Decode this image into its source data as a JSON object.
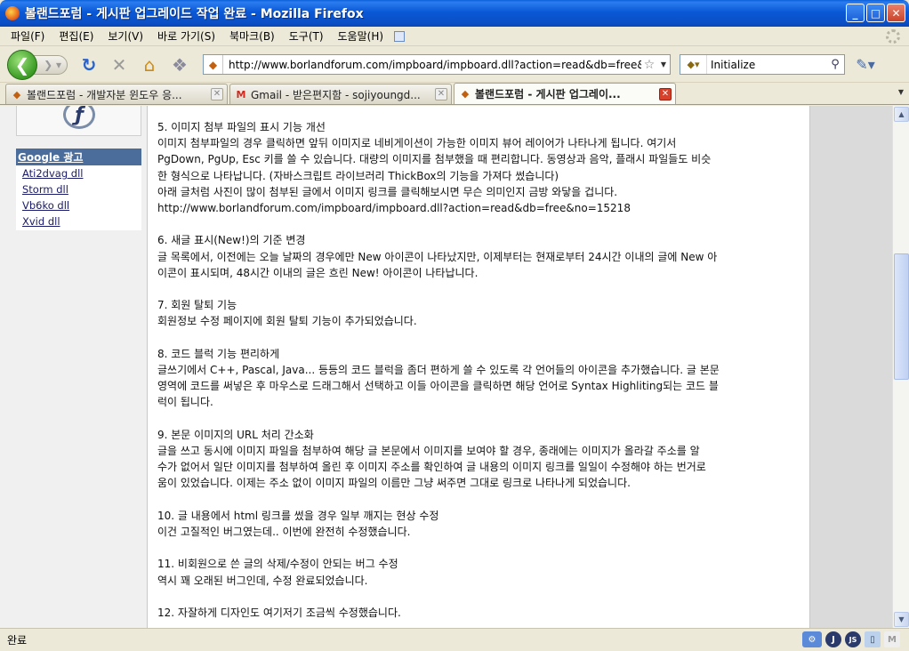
{
  "window": {
    "title": "볼랜드포럼 - 게시판 업그레이드 작업 완료 - Mozilla Firefox",
    "minimize": "_",
    "maximize": "□",
    "close": "✕"
  },
  "menu": {
    "items": [
      "파일(F)",
      "편집(E)",
      "보기(V)",
      "바로 가기(S)",
      "북마크(B)",
      "도구(T)",
      "도움말(H)"
    ]
  },
  "nav": {
    "url": "http://www.borlandforum.com/impboard/impboard.dll?action=read&db=free&no",
    "search_value": "Initialize"
  },
  "tabs": [
    {
      "label": "볼랜드포럼 - 개발자분 윈도우 응...",
      "icon": "borland-icon",
      "active": false
    },
    {
      "label": "Gmail - 받은편지함 - sojiyoungd...",
      "icon": "gmail-icon",
      "active": false
    },
    {
      "label": "볼랜드포럼 - 게시판 업그레이...",
      "icon": "borland-icon",
      "active": true
    }
  ],
  "sidebar": {
    "ads_title": "Google 광고",
    "ads": [
      "Ati2dvag dll",
      "Storm dll",
      "Vb6ko dll",
      "Xvid dll"
    ]
  },
  "article": {
    "sections": [
      {
        "heading": "5. 이미지 첨부 파일의 표시 기능 개선",
        "lines": [
          "이미지 첨부파일의 경우 클릭하면 앞뒤 이미지로 네비게이션이 가능한 이미지 뷰어 레이어가 나타나게 됩니다. 여기서",
          "PgDown, PgUp, Esc 키를 쓸 수 있습니다. 대량의 이미지를 첨부했을 때 편리합니다. 동영상과 음악, 플래시 파일들도 비슷",
          "한 형식으로 나타납니다. (자바스크립트 라이브러리 ThickBox의 기능을 가져다 썼습니다)",
          "아래 글처럼 사진이 많이 첨부된 글에서 이미지 링크를 클릭해보시면 무슨 의미인지 금방 와닿을 겁니다.",
          "http://www.borlandforum.com/impboard/impboard.dll?action=read&db=free&no=15218"
        ]
      },
      {
        "heading": "6. 새글 표시(New!)의 기준 변경",
        "lines": [
          "글 목록에서, 이전에는 오늘 날짜의 경우에만 New 아이콘이 나타났지만, 이제부터는 현재로부터 24시간 이내의 글에 New 아",
          "이콘이 표시되며, 48시간 이내의 글은 흐린 New! 아이콘이 나타납니다."
        ]
      },
      {
        "heading": "7. 회원 탈퇴 기능",
        "lines": [
          "회원정보 수정 페이지에 회원 탈퇴 기능이 추가되었습니다."
        ]
      },
      {
        "heading": "8. 코드 블럭 기능 편리하게",
        "lines": [
          "글쓰기에서 C++, Pascal, Java... 등등의 코드 블럭을 좀더 편하게 쓸 수 있도록 각 언어들의 아이콘을 추가했습니다. 글 본문",
          "영역에 코드를 써넣은 후 마우스로 드래그해서 선택하고 이들 아이콘을 클릭하면 해당 언어로 Syntax Highliting되는 코드 블",
          "럭이 됩니다."
        ]
      },
      {
        "heading": "9. 본문 이미지의 URL 처리 간소화",
        "lines": [
          "글을 쓰고 동시에 이미지 파일을 첨부하여 해당 글 본문에서 이미지를 보여야 할 경우, 종래에는 이미지가 올라갈 주소를 알",
          "수가 없어서 일단 이미지를 첨부하여 올린 후 이미지 주소를 확인하여 글 내용의 이미지 링크를 일일이 수정해야 하는 번거로",
          "움이 있었습니다. 이제는 주소 없이 이미지 파일의 이름만 그냥 써주면 그대로 링크로 나타나게 되었습니다."
        ]
      },
      {
        "heading": "10. 글 내용에서 html 링크를 썼을 경우 일부 깨지는 현상 수정",
        "lines": [
          "이건 고질적인 버그였는데.. 이번에 완전히 수정했습니다."
        ]
      },
      {
        "heading": "11. 비회원으로 쓴 글의 삭제/수정이 안되는 버그 수정",
        "lines": [
          "역시 꽤 오래된 버그인데, 수정 완료되었습니다."
        ]
      },
      {
        "heading": "12. 자잘하게 디자인도 여기저기 조금씩 수정했습니다.",
        "lines": []
      }
    ]
  },
  "status": {
    "text": "완료"
  },
  "colors": {
    "titlebar": "#0a58d6",
    "ads_header": "#4a6d9c",
    "close_tab": "#d8402a"
  }
}
